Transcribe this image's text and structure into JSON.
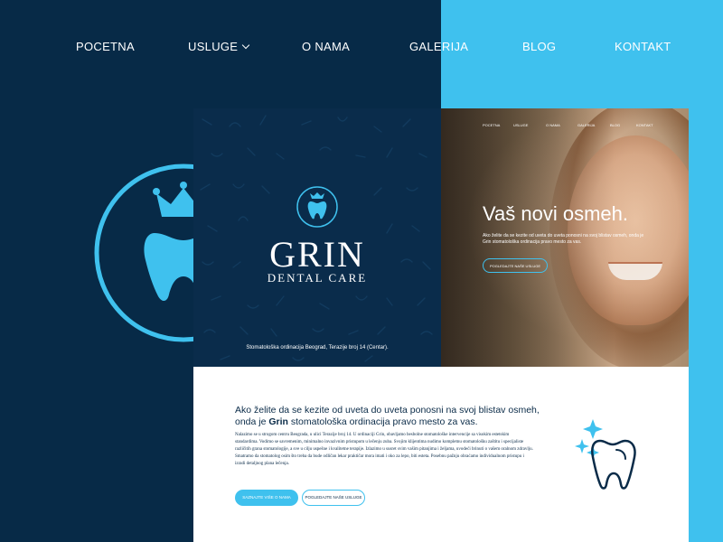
{
  "nav": {
    "items": [
      "POCETNA",
      "USLUGE",
      "O NAMA",
      "GALERIJA",
      "BLOG",
      "KONTAKT"
    ]
  },
  "brand": {
    "title": "GRIN",
    "subtitle": "DENTAL CARE",
    "address": "Stomatološka ordinacija Beograd, Terazije broj 14 (Centar)."
  },
  "hero": {
    "mini_nav": [
      "POCETNA",
      "USLUGE",
      "O NAMA",
      "GALERIJA",
      "BLOG",
      "KONTAKT"
    ],
    "title": "Vaš novi osmeh.",
    "text": "Ako želite da se kezite od uveta do uveta ponosni na svoj blistav osmeh, onda je Grin stomatološka ordinacija pravo mesto za vas.",
    "button": "POGLEDAJTE NAŠE USLUGE"
  },
  "content": {
    "lead_part1": "Ako želite da se kezite od uveta do uveta ponosni na svoj blistav osmeh, onda je ",
    "lead_bold": "Grin",
    "lead_part2": " stomatološka ordinacija pravo mesto za vas.",
    "body": "Nalazimo se u strogom centru Beograda, u ulici Terazije broj 14. U ordinaciji Grin, obavljamo besbolne stomatološke intervencije sa visokim estetskim standardima. Vodimo se savremenim, minimalno invazivnim pristupom u lečenju zuba. Svojim klijentima nudimo kompletnu stomatološku zaštitu i specijaliste različitih grana stomatologije, a sve u cilju uspešne i kvalitetne terapije. Izlazimo u susret svim vašim pitanjima i željama, uvodeći brinuti o vašem oralnom zdravlju. Smatramo da stomatolog osim što treba da bude odličan lekar praktičar mora imati i oko za lepo, biti estetа. Posebnu pažnju obraćamo individualnom pristupu i izradi detaljnog plana lečenja.",
    "btn_primary": "SAZNAJTE VIŠE O NAMA",
    "btn_secondary": "POGLEDAJTE NAŠE USLUGE"
  },
  "colors": {
    "navy": "#072a47",
    "accent": "#3fc1ee",
    "white": "#ffffff"
  },
  "icons": [
    "crown-tooth-logo-icon",
    "chevron-down-icon",
    "sparkle-tooth-icon"
  ]
}
